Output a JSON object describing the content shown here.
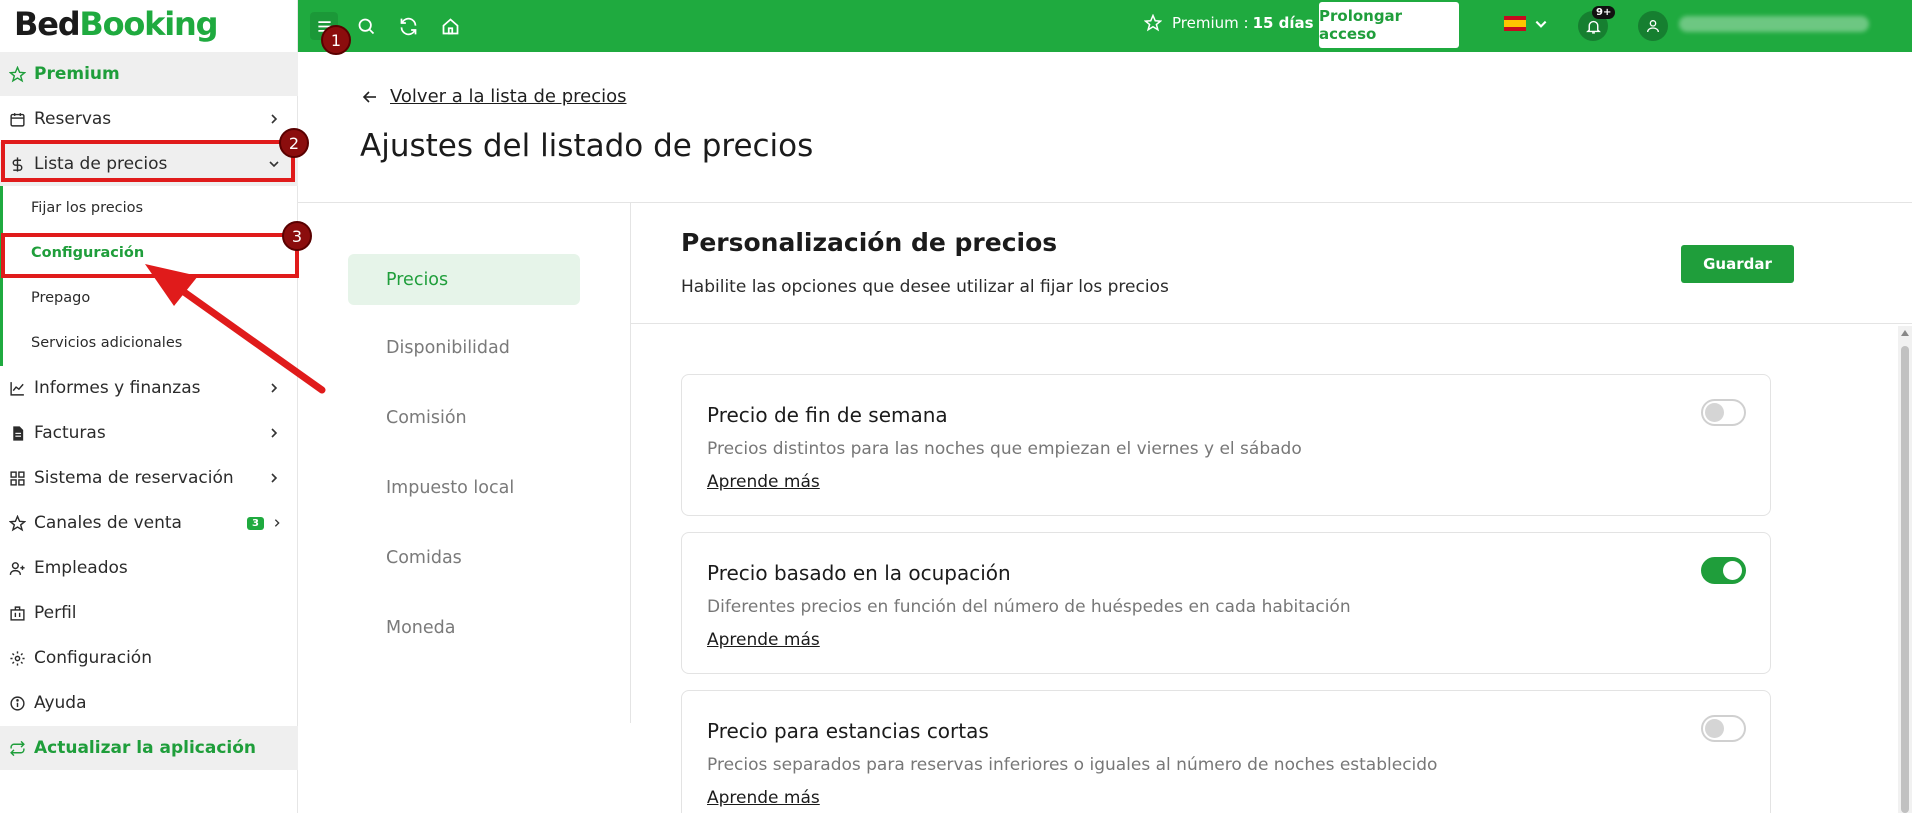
{
  "brand": {
    "part1": "Bed",
    "part2": "Booking"
  },
  "sidebar": {
    "items": [
      {
        "key": "premium",
        "label": "Premium",
        "icon": "star-icon"
      },
      {
        "key": "reservas",
        "label": "Reservas",
        "icon": "calendar-icon"
      },
      {
        "key": "lista-precios",
        "label": "Lista de precios",
        "icon": "dollar-icon"
      },
      {
        "key": "informes",
        "label": "Informes y finanzas",
        "icon": "chart-icon"
      },
      {
        "key": "facturas",
        "label": "Facturas",
        "icon": "invoice-icon"
      },
      {
        "key": "sistema",
        "label": "Sistema de reservación",
        "icon": "grid-icon"
      },
      {
        "key": "canales",
        "label": "Canales de venta",
        "icon": "star-icon",
        "badge": "3"
      },
      {
        "key": "empleados",
        "label": "Empleados",
        "icon": "user-plus-icon"
      },
      {
        "key": "perfil",
        "label": "Perfil",
        "icon": "building-icon"
      },
      {
        "key": "configuracion",
        "label": "Configuración",
        "icon": "gear-icon"
      },
      {
        "key": "ayuda",
        "label": "Ayuda",
        "icon": "info-icon"
      },
      {
        "key": "actualizar",
        "label": "Actualizar la aplicación",
        "icon": "refresh-icon"
      }
    ],
    "sub_items": [
      {
        "label": "Fijar los precios"
      },
      {
        "label": "Configuración"
      },
      {
        "label": "Prepago"
      },
      {
        "label": "Servicios adicionales"
      }
    ]
  },
  "topbar": {
    "premium_label": "Premium :",
    "premium_days": "15 días",
    "prolong_button": "Prolongar acceso",
    "notifications_badge": "9+"
  },
  "header": {
    "back_link": "Volver a la lista de precios",
    "title": "Ajustes del listado de precios"
  },
  "settings_nav": [
    {
      "label": "Precios"
    },
    {
      "label": "Disponibilidad"
    },
    {
      "label": "Comisión"
    },
    {
      "label": "Impuesto local"
    },
    {
      "label": "Comidas"
    },
    {
      "label": "Moneda"
    }
  ],
  "section": {
    "title": "Personalización de precios",
    "subtitle": "Habilite las opciones que desee utilizar al fijar los precios",
    "save_button": "Guardar"
  },
  "cards": [
    {
      "title": "Precio de fin de semana",
      "description": "Precios distintos para las noches que empiezan el viernes y el sábado",
      "link": "Aprende más",
      "enabled": false
    },
    {
      "title": "Precio basado en la ocupación",
      "description": "Diferentes precios en función del número de huéspedes en cada habitación",
      "link": "Aprende más",
      "enabled": true
    },
    {
      "title": "Precio para estancias cortas",
      "description": "Precios separados para reservas inferiores o iguales al número de noches establecido",
      "link": "Aprende más",
      "enabled": false
    }
  ],
  "annotations": [
    "1",
    "2",
    "3"
  ],
  "colors": {
    "brand_green": "#1faa3f",
    "annotation_red": "#e01b1b",
    "annotation_circle": "#8b0d0d"
  }
}
